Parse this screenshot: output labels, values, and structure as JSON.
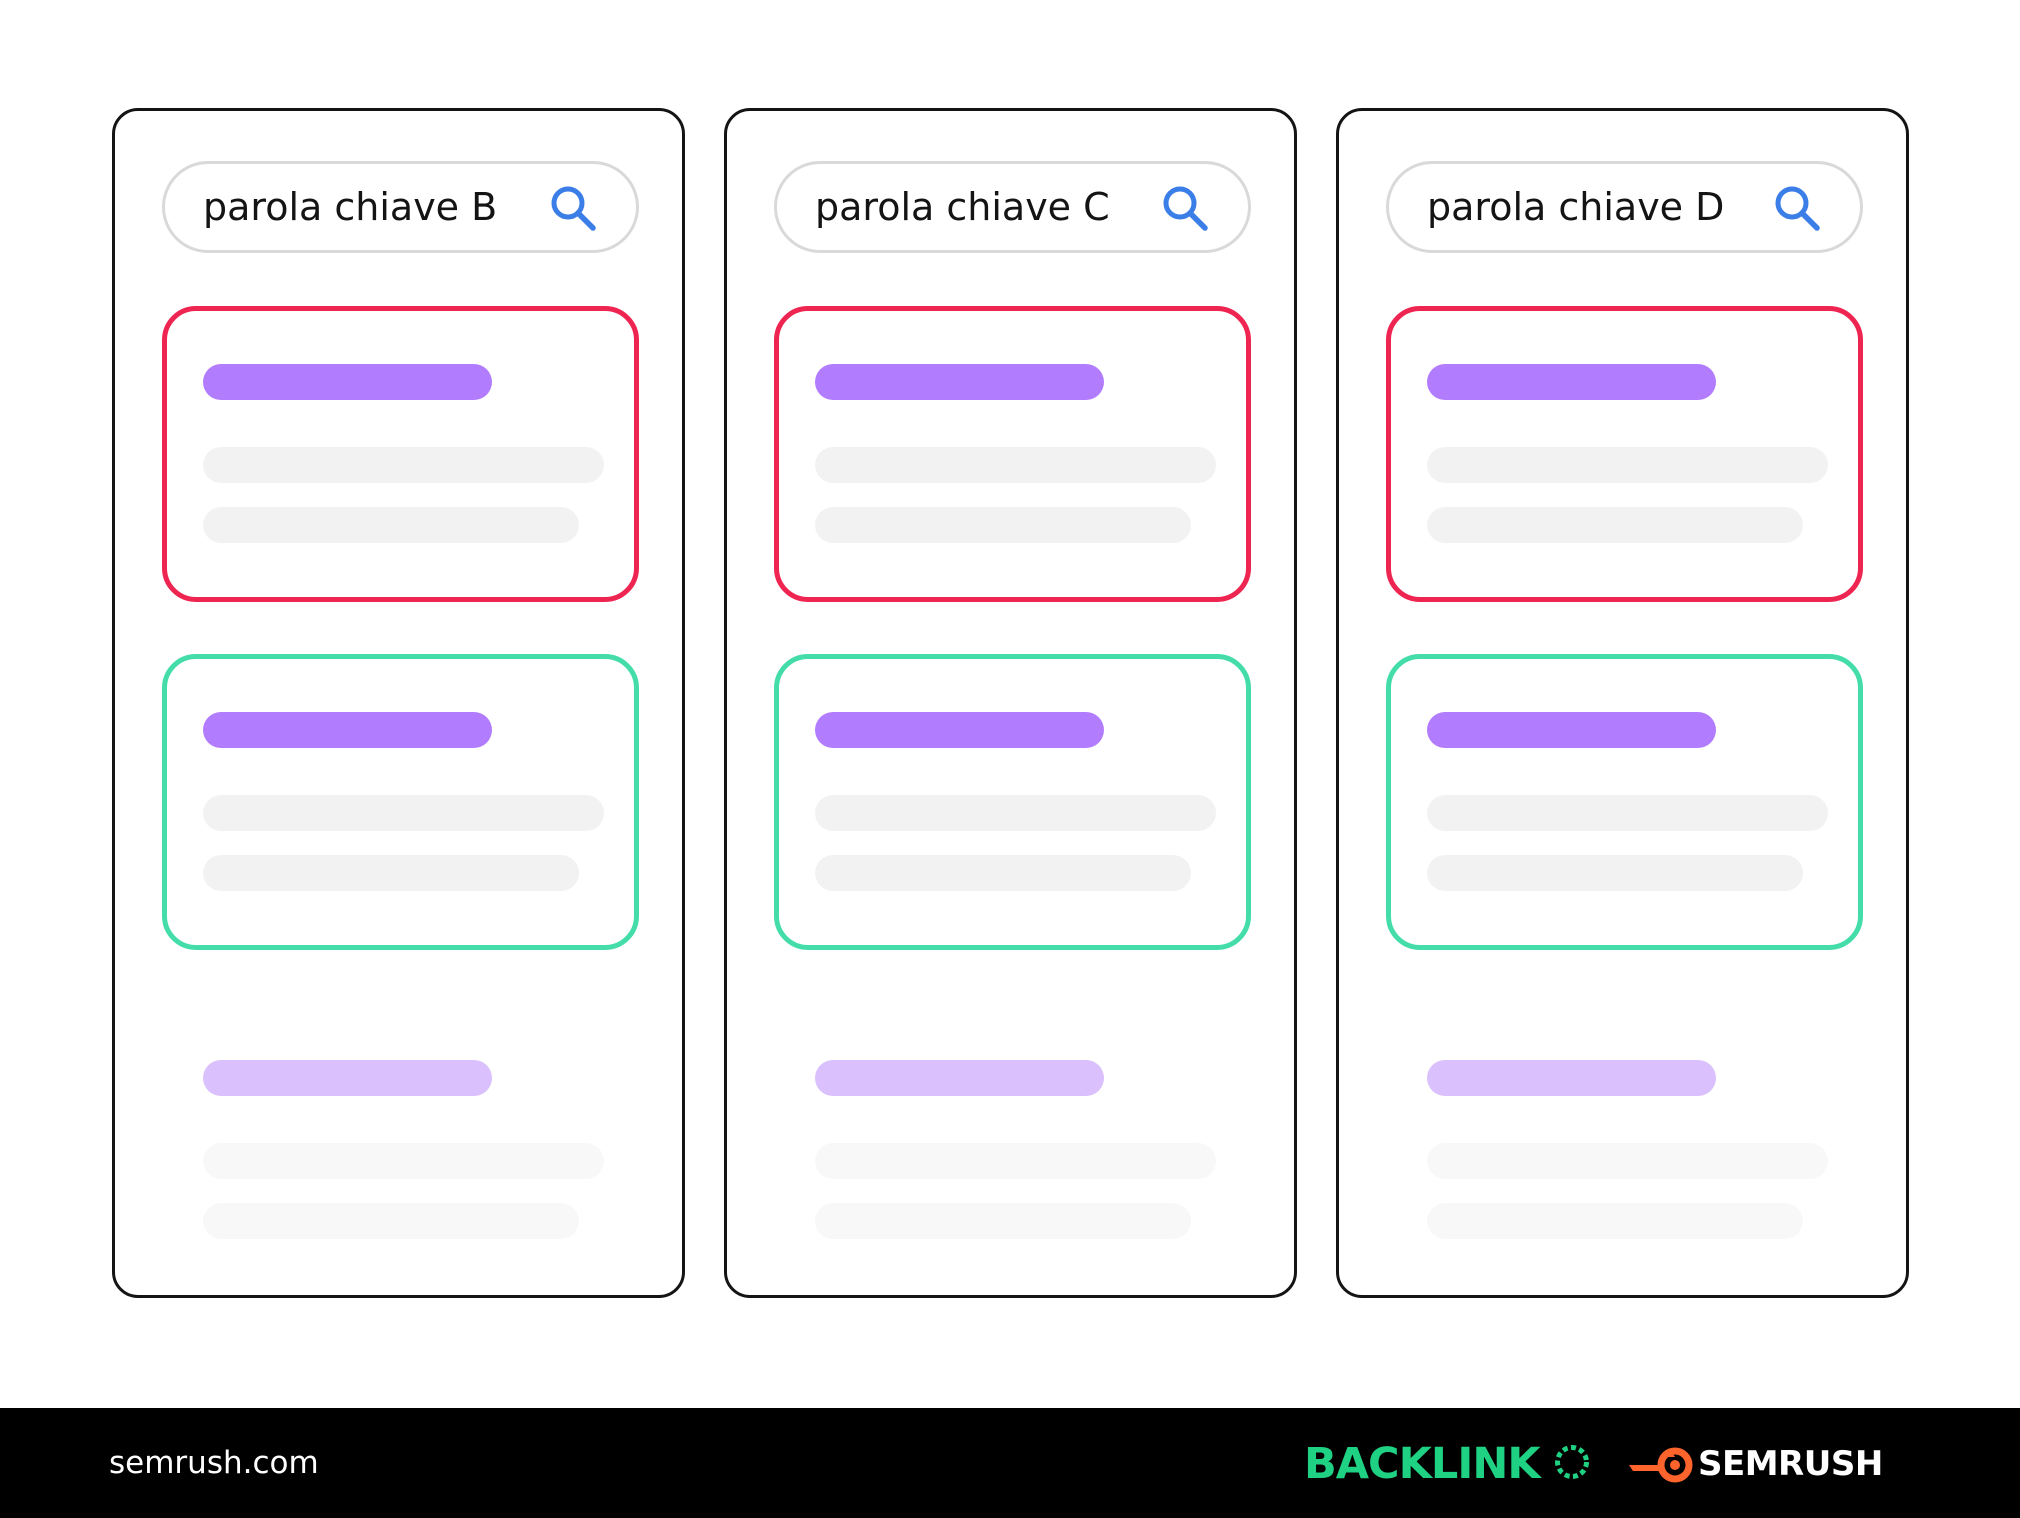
{
  "panels": [
    {
      "query": "parola chiave B"
    },
    {
      "query": "parola chiave C"
    },
    {
      "query": "parola chiave D"
    }
  ],
  "colors": {
    "panel_border": "#141414",
    "search_border": "#d9d9d9",
    "search_icon": "#3b7ee8",
    "result_bad_border": "#ee2451",
    "result_good_border": "#44ddaa",
    "title_bar": "#b27cff",
    "title_bar_faded": "#dac0fd",
    "text_bar": "#f2f2f2",
    "footer_bg": "#000000",
    "backlinko_green": "#1fd183",
    "semrush_orange": "#ff642d"
  },
  "footer": {
    "site": "semrush.com",
    "brand_backlinko": "BACKLINK",
    "brand_semrush": "SEMRUSH"
  }
}
